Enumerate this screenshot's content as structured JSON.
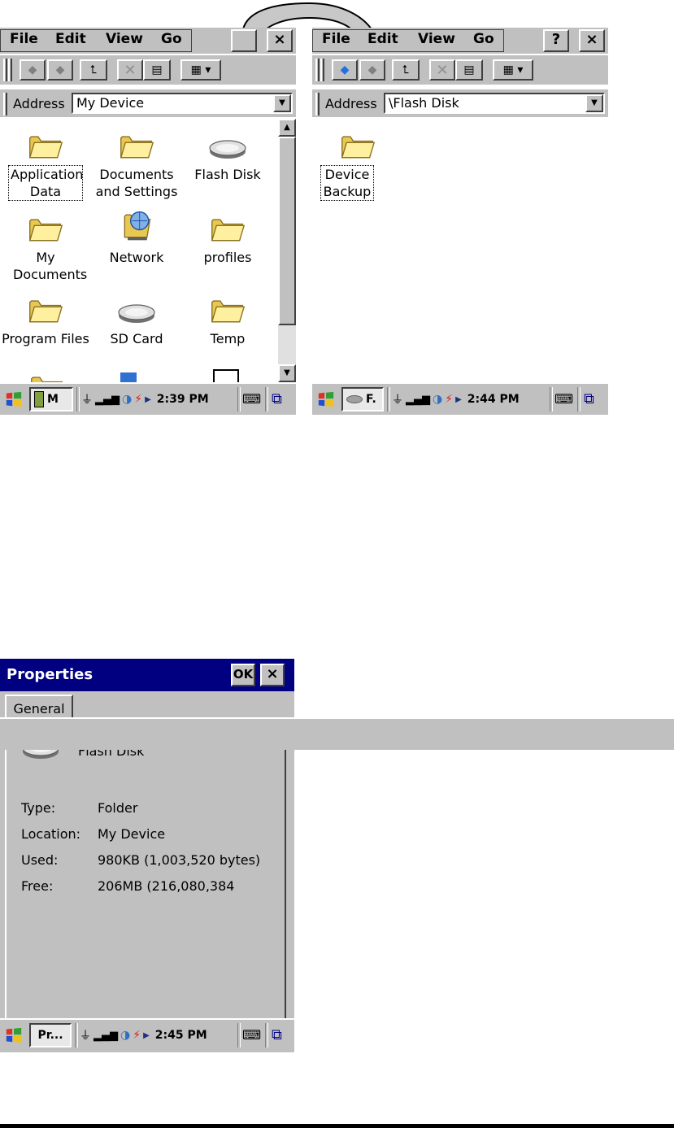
{
  "screen1": {
    "menu": {
      "file": "File",
      "edit": "Edit",
      "view": "View",
      "go": "Go",
      "close": "×"
    },
    "address": {
      "label": "Address",
      "value": "My Device"
    },
    "items": [
      {
        "label": "Application Data",
        "icon": "folder-icon",
        "selected": true
      },
      {
        "label": "Documents and Settings",
        "icon": "folder-icon"
      },
      {
        "label": "Flash Disk",
        "icon": "disk-icon"
      },
      {
        "label": "My Documents",
        "icon": "folder-icon"
      },
      {
        "label": "Network",
        "icon": "network-icon"
      },
      {
        "label": "profiles",
        "icon": "folder-icon"
      },
      {
        "label": "Program Files",
        "icon": "folder-icon"
      },
      {
        "label": "SD Card",
        "icon": "disk-icon"
      },
      {
        "label": "Temp",
        "icon": "folder-icon"
      }
    ],
    "taskbar": {
      "task": "M",
      "time": "2:39 PM"
    }
  },
  "screen2": {
    "menu": {
      "file": "File",
      "edit": "Edit",
      "view": "View",
      "go": "Go",
      "help": "?",
      "close": "×"
    },
    "address": {
      "label": "Address",
      "value": "\\Flash Disk"
    },
    "items": [
      {
        "label": "Device Backup",
        "icon": "folder-icon",
        "selected": true
      }
    ],
    "taskbar": {
      "task": "F.",
      "time": "2:44 PM"
    }
  },
  "screen3": {
    "title": "Properties",
    "ok": "OK",
    "close": "×",
    "tab": "General",
    "name": "Flash Disk",
    "rows": [
      {
        "key": "Type:",
        "value": "Folder"
      },
      {
        "key": "Location:",
        "value": "My Device"
      },
      {
        "key": "Used:",
        "value": "980KB (1,003,520 bytes)"
      },
      {
        "key": "Free:",
        "value": "206MB (216,080,384"
      }
    ],
    "taskbar": {
      "task": "Pr...",
      "time": "2:45 PM"
    }
  },
  "colors": {
    "titlebar": "#000080",
    "chrome": "#c0c0c0",
    "folder": "#ffe680"
  }
}
